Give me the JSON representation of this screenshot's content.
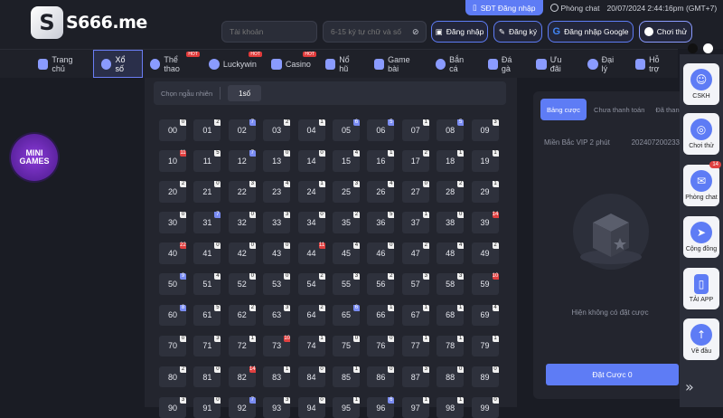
{
  "header": {
    "logo_text": "S666.me",
    "sdt_login_label": "SĐT Đăng nhập",
    "room_chat_label": "Phòng chat",
    "datetime": "20/07/2024 2:44:16pm (GMT+7)",
    "account_placeholder": "Tài khoản",
    "password_placeholder": "6-15 ký tự chữ và số",
    "login_label": "Đăng nhập",
    "register_label": "Đăng ký",
    "google_login_label": "Đăng nhập Google",
    "try_play_label": "Chơi thử"
  },
  "nav": [
    {
      "label": "Trang chủ",
      "icon": "home-icon"
    },
    {
      "label": "Xổ số",
      "icon": "lottery-icon"
    },
    {
      "label": "Thể thao",
      "icon": "sports-icon",
      "hot": true
    },
    {
      "label": "Luckywin",
      "icon": "luckywin-icon",
      "hot": true
    },
    {
      "label": "Casino",
      "icon": "casino-icon",
      "hot": true
    },
    {
      "label": "Nổ hũ",
      "icon": "jackpot-icon"
    },
    {
      "label": "Game bài",
      "icon": "cards-icon"
    },
    {
      "label": "Bắn cá",
      "icon": "fish-icon"
    },
    {
      "label": "Đá gà",
      "icon": "rooster-icon"
    },
    {
      "label": "Ưu đãi",
      "icon": "gift-icon"
    },
    {
      "label": "Đại lý",
      "icon": "agent-icon"
    },
    {
      "label": "Hỗ trợ",
      "icon": "support-icon"
    }
  ],
  "nav_hot_label": "HOT",
  "mini_games": {
    "line1": "MINI",
    "line2": "GAMES"
  },
  "lottery": {
    "random_label": "Chọn ngẫu nhiên",
    "random_button": "1số",
    "numbers": [
      {
        "n": "00",
        "c": "0",
        "t": "w"
      },
      {
        "n": "01",
        "c": "2",
        "t": "w"
      },
      {
        "n": "02",
        "c": "7",
        "t": "b"
      },
      {
        "n": "03",
        "c": "2",
        "t": "w"
      },
      {
        "n": "04",
        "c": "1",
        "t": "w"
      },
      {
        "n": "05",
        "c": "6",
        "t": "b"
      },
      {
        "n": "06",
        "c": "5",
        "t": "b"
      },
      {
        "n": "07",
        "c": "1",
        "t": "w"
      },
      {
        "n": "08",
        "c": "5",
        "t": "b"
      },
      {
        "n": "09",
        "c": "3",
        "t": "w"
      },
      {
        "n": "10",
        "c": "11",
        "t": "r"
      },
      {
        "n": "11",
        "c": "5",
        "t": "w"
      },
      {
        "n": "12",
        "c": "7",
        "t": "b"
      },
      {
        "n": "13",
        "c": "0",
        "t": "w"
      },
      {
        "n": "14",
        "c": "0",
        "t": "w"
      },
      {
        "n": "15",
        "c": "4",
        "t": "w"
      },
      {
        "n": "16",
        "c": "1",
        "t": "w"
      },
      {
        "n": "17",
        "c": "2",
        "t": "w"
      },
      {
        "n": "18",
        "c": "1",
        "t": "w"
      },
      {
        "n": "19",
        "c": "1",
        "t": "w"
      },
      {
        "n": "20",
        "c": "2",
        "t": "w"
      },
      {
        "n": "21",
        "c": "0",
        "t": "w"
      },
      {
        "n": "22",
        "c": "3",
        "t": "w"
      },
      {
        "n": "23",
        "c": "4",
        "t": "w"
      },
      {
        "n": "24",
        "c": "1",
        "t": "w"
      },
      {
        "n": "25",
        "c": "3",
        "t": "w"
      },
      {
        "n": "26",
        "c": "4",
        "t": "w"
      },
      {
        "n": "27",
        "c": "0",
        "t": "w"
      },
      {
        "n": "28",
        "c": "2",
        "t": "w"
      },
      {
        "n": "29",
        "c": "1",
        "t": "w"
      },
      {
        "n": "30",
        "c": "0",
        "t": "w"
      },
      {
        "n": "31",
        "c": "7",
        "t": "b"
      },
      {
        "n": "32",
        "c": "0",
        "t": "w"
      },
      {
        "n": "33",
        "c": "3",
        "t": "w"
      },
      {
        "n": "34",
        "c": "0",
        "t": "w"
      },
      {
        "n": "35",
        "c": "2",
        "t": "w"
      },
      {
        "n": "36",
        "c": "5",
        "t": "w"
      },
      {
        "n": "37",
        "c": "1",
        "t": "w"
      },
      {
        "n": "38",
        "c": "0",
        "t": "w"
      },
      {
        "n": "39",
        "c": "14",
        "t": "r"
      },
      {
        "n": "40",
        "c": "22",
        "t": "r"
      },
      {
        "n": "41",
        "c": "0",
        "t": "w"
      },
      {
        "n": "42",
        "c": "0",
        "t": "w"
      },
      {
        "n": "43",
        "c": "0",
        "t": "w"
      },
      {
        "n": "44",
        "c": "11",
        "t": "r"
      },
      {
        "n": "45",
        "c": "4",
        "t": "w"
      },
      {
        "n": "46",
        "c": "0",
        "t": "w"
      },
      {
        "n": "47",
        "c": "2",
        "t": "w"
      },
      {
        "n": "48",
        "c": "4",
        "t": "w"
      },
      {
        "n": "49",
        "c": "2",
        "t": "w"
      },
      {
        "n": "50",
        "c": "9",
        "t": "b"
      },
      {
        "n": "51",
        "c": "4",
        "t": "w"
      },
      {
        "n": "52",
        "c": "0",
        "t": "w"
      },
      {
        "n": "53",
        "c": "0",
        "t": "w"
      },
      {
        "n": "54",
        "c": "2",
        "t": "w"
      },
      {
        "n": "55",
        "c": "3",
        "t": "w"
      },
      {
        "n": "56",
        "c": "2",
        "t": "w"
      },
      {
        "n": "57",
        "c": "3",
        "t": "w"
      },
      {
        "n": "58",
        "c": "3",
        "t": "w"
      },
      {
        "n": "59",
        "c": "10",
        "t": "r"
      },
      {
        "n": "60",
        "c": "8",
        "t": "b"
      },
      {
        "n": "61",
        "c": "5",
        "t": "w"
      },
      {
        "n": "62",
        "c": "2",
        "t": "w"
      },
      {
        "n": "63",
        "c": "3",
        "t": "w"
      },
      {
        "n": "64",
        "c": "2",
        "t": "w"
      },
      {
        "n": "65",
        "c": "6",
        "t": "b"
      },
      {
        "n": "66",
        "c": "1",
        "t": "w"
      },
      {
        "n": "67",
        "c": "1",
        "t": "w"
      },
      {
        "n": "68",
        "c": "1",
        "t": "w"
      },
      {
        "n": "69",
        "c": "4",
        "t": "w"
      },
      {
        "n": "70",
        "c": "0",
        "t": "w"
      },
      {
        "n": "71",
        "c": "3",
        "t": "w"
      },
      {
        "n": "72",
        "c": "1",
        "t": "w"
      },
      {
        "n": "73",
        "c": "10",
        "t": "r"
      },
      {
        "n": "74",
        "c": "1",
        "t": "w"
      },
      {
        "n": "75",
        "c": "0",
        "t": "w"
      },
      {
        "n": "76",
        "c": "0",
        "t": "w"
      },
      {
        "n": "77",
        "c": "1",
        "t": "w"
      },
      {
        "n": "78",
        "c": "1",
        "t": "w"
      },
      {
        "n": "79",
        "c": "1",
        "t": "w"
      },
      {
        "n": "80",
        "c": "2",
        "t": "w"
      },
      {
        "n": "81",
        "c": "0",
        "t": "w"
      },
      {
        "n": "82",
        "c": "14",
        "t": "r"
      },
      {
        "n": "83",
        "c": "1",
        "t": "w"
      },
      {
        "n": "84",
        "c": "0",
        "t": "w"
      },
      {
        "n": "85",
        "c": "1",
        "t": "w"
      },
      {
        "n": "86",
        "c": "0",
        "t": "w"
      },
      {
        "n": "87",
        "c": "3",
        "t": "w"
      },
      {
        "n": "88",
        "c": "0",
        "t": "w"
      },
      {
        "n": "89",
        "c": "0",
        "t": "w"
      },
      {
        "n": "90",
        "c": "3",
        "t": "w"
      },
      {
        "n": "91",
        "c": "0",
        "t": "w"
      },
      {
        "n": "92",
        "c": "7",
        "t": "b"
      },
      {
        "n": "93",
        "c": "3",
        "t": "w"
      },
      {
        "n": "94",
        "c": "0",
        "t": "w"
      },
      {
        "n": "95",
        "c": "1",
        "t": "w"
      },
      {
        "n": "96",
        "c": "6",
        "t": "b"
      },
      {
        "n": "97",
        "c": "1",
        "t": "w"
      },
      {
        "n": "98",
        "c": "1",
        "t": "w"
      },
      {
        "n": "99",
        "c": "0",
        "t": "w"
      }
    ]
  },
  "bet_panel": {
    "tabs": [
      "Bảng cược",
      "Chưa thanh toán",
      "Đã thanh toán"
    ],
    "game_name": "Miền Bắc VIP 2 phút",
    "game_id": "202407200233",
    "empty_text": "Hiện không có đặt cược",
    "place_bet_label": "Đặt Cược 0"
  },
  "sidebar": [
    {
      "label": "CSKH",
      "icon": "support-agent-icon"
    },
    {
      "label": "Chơi thử",
      "icon": "gamepad-icon"
    },
    {
      "label": "Phòng chat",
      "icon": "chat-icon",
      "badge": "14"
    },
    {
      "label": "Cộng đồng",
      "icon": "telegram-icon"
    },
    {
      "label": "TẢI APP",
      "icon": "download-app-icon"
    },
    {
      "label": "Về đầu",
      "icon": "arrow-up-icon"
    }
  ],
  "colors": {
    "accent": "#5e7cf5",
    "background": "#1a1c24",
    "panel": "#23252e",
    "cell": "#2e313c",
    "hot": "#e04040"
  }
}
